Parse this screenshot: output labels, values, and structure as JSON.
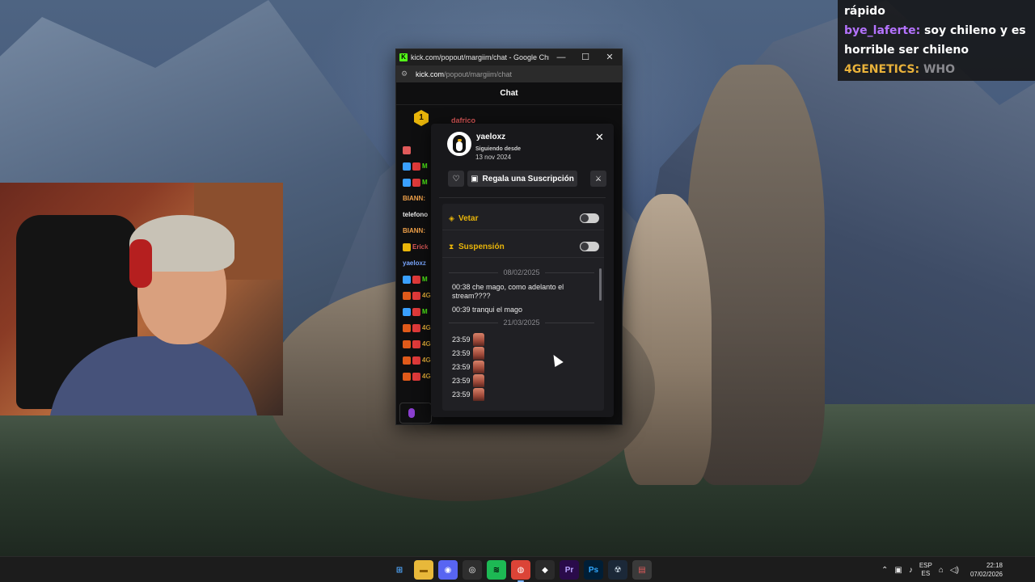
{
  "overlay_chat": {
    "lines": [
      {
        "user": "",
        "user_color": "#ffffff",
        "text": "rápido"
      },
      {
        "user": "bye_laferte:",
        "user_color": "#b573ff",
        "text": "soy chileno y es"
      },
      {
        "user": "",
        "user_color": "#ffffff",
        "text": "horrible ser chileno"
      },
      {
        "user": "4GENETICS:",
        "user_color": "#e9b23a",
        "text": "WHO"
      }
    ]
  },
  "browser": {
    "title": "kick.com/popout/margiim/chat - Google Chro...",
    "url_host": "kick.com",
    "url_path": "/popout/margiim/chat",
    "favicon": "K",
    "minimize": "—",
    "maximize": "☐",
    "close": "✕"
  },
  "chat": {
    "header": "Chat",
    "pinned_badge": "1",
    "pinned_user": "dafrico",
    "lines": [
      {
        "name": "",
        "color": "#e05a5a",
        "badges": [
          "#e05a5a"
        ]
      },
      {
        "name": "M",
        "color": "#53fc18",
        "badges": [
          "#3aa0ff",
          "#e03a3a"
        ]
      },
      {
        "name": "M",
        "color": "#53fc18",
        "badges": [
          "#3aa0ff",
          "#e03a3a"
        ]
      },
      {
        "name": "BIANN:",
        "color": "#f2a24a",
        "badges": []
      },
      {
        "name": "telefono",
        "color": "#eaeaea",
        "badges": []
      },
      {
        "name": "BIANN:",
        "color": "#f2a24a",
        "badges": []
      },
      {
        "name": "Erick",
        "color": "#e05a5a",
        "badges": [
          "#e9b50a"
        ]
      },
      {
        "name": "yaeloxz",
        "color": "#7aa7ff",
        "badges": []
      },
      {
        "name": "M",
        "color": "#53fc18",
        "badges": [
          "#3aa0ff",
          "#e03a3a"
        ]
      },
      {
        "name": "4GE",
        "color": "#e9b23a",
        "badges": [
          "#e05a1a",
          "#e03a3a"
        ]
      },
      {
        "name": "M",
        "color": "#53fc18",
        "badges": [
          "#3aa0ff",
          "#e03a3a"
        ]
      },
      {
        "name": "4GE",
        "color": "#e9b23a",
        "badges": [
          "#e05a1a",
          "#e03a3a"
        ]
      },
      {
        "name": "4GE",
        "color": "#e9b23a",
        "badges": [
          "#e05a1a",
          "#e03a3a"
        ]
      },
      {
        "name": "4GE",
        "color": "#e9b23a",
        "badges": [
          "#e05a1a",
          "#e03a3a"
        ]
      },
      {
        "name": "4GE",
        "color": "#e9b23a",
        "badges": [
          "#e05a1a",
          "#e03a3a"
        ]
      }
    ]
  },
  "usercard": {
    "username": "yaeloxz",
    "following_label": "Siguiendo desde",
    "following_date": "13 nov 2024",
    "close": "✕",
    "gift_label": "Regala una Suscripción",
    "ban_label": "Vetar",
    "timeout_label": "Suspensión",
    "history": [
      {
        "type": "date",
        "text": "08/02/2025"
      },
      {
        "type": "msg",
        "text": "00:38 che mago, como adelanto el stream????"
      },
      {
        "type": "msg",
        "text": "00:39 tranqui el mago"
      },
      {
        "type": "date",
        "text": "21/03/2025"
      },
      {
        "type": "emote",
        "time": "23:59"
      },
      {
        "type": "emote",
        "time": "23:59"
      },
      {
        "type": "emote",
        "time": "23:59"
      },
      {
        "type": "emote",
        "time": "23:59"
      },
      {
        "type": "emote",
        "time": "23:59"
      }
    ]
  },
  "taskbar": {
    "apps": [
      {
        "name": "start",
        "glyph": "⊞",
        "bg": "#1c1c1c",
        "fg": "#4fa9ff",
        "active": false
      },
      {
        "name": "explorer",
        "glyph": "▬",
        "bg": "#e8b83a",
        "fg": "#8a5b00",
        "active": false
      },
      {
        "name": "discord",
        "glyph": "◉",
        "bg": "#5865f2",
        "fg": "#ffffff",
        "active": false
      },
      {
        "name": "obs",
        "glyph": "◎",
        "bg": "#2e2e2e",
        "fg": "#ffffff",
        "active": false
      },
      {
        "name": "spotify",
        "glyph": "≋",
        "bg": "#1db954",
        "fg": "#000000",
        "active": false
      },
      {
        "name": "chrome",
        "glyph": "◍",
        "bg": "#db4437",
        "fg": "#ffffff",
        "active": true
      },
      {
        "name": "app",
        "glyph": "◆",
        "bg": "#2a2a2a",
        "fg": "#ffffff",
        "active": false
      },
      {
        "name": "premiere",
        "glyph": "Pr",
        "bg": "#2a0b4a",
        "fg": "#b8a3ff",
        "active": false
      },
      {
        "name": "photoshop",
        "glyph": "Ps",
        "bg": "#001e36",
        "fg": "#31a8ff",
        "active": false
      },
      {
        "name": "steam",
        "glyph": "☢",
        "bg": "#1b2838",
        "fg": "#c7d5e0",
        "active": false
      },
      {
        "name": "app2",
        "glyph": "▤",
        "bg": "#3a3a3a",
        "fg": "#e05a5a",
        "active": false
      }
    ],
    "lang_top": "ESP",
    "lang_bottom": "ES",
    "time": "22:18",
    "date": "07/02/2026"
  }
}
